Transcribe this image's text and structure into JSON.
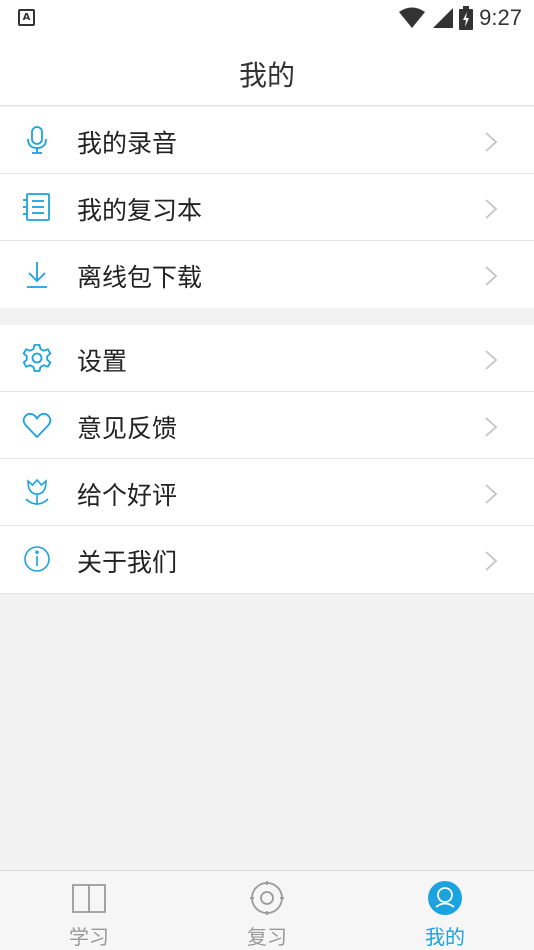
{
  "status_bar": {
    "time": "9:27",
    "notification": "A"
  },
  "header": {
    "title": "我的"
  },
  "menu_group_1": [
    {
      "label": "我的录音",
      "icon": "microphone-icon"
    },
    {
      "label": "我的复习本",
      "icon": "notebook-icon"
    },
    {
      "label": "离线包下载",
      "icon": "download-icon"
    }
  ],
  "menu_group_2": [
    {
      "label": "设置",
      "icon": "gear-icon"
    },
    {
      "label": "意见反馈",
      "icon": "heart-icon"
    },
    {
      "label": "给个好评",
      "icon": "flower-icon"
    },
    {
      "label": "关于我们",
      "icon": "info-icon"
    }
  ],
  "tabs": [
    {
      "label": "学习",
      "icon": "book-icon",
      "active": false
    },
    {
      "label": "复习",
      "icon": "target-icon",
      "active": false
    },
    {
      "label": "我的",
      "icon": "user-icon",
      "active": true
    }
  ],
  "colors": {
    "accent": "#1aa3df",
    "inactive": "#9a9a9a",
    "background": "#f2f2f2"
  }
}
